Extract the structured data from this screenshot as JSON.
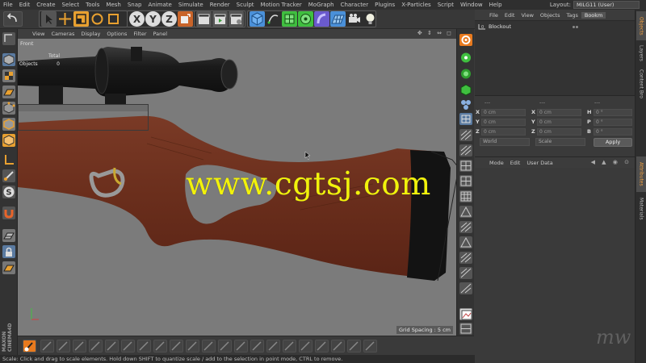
{
  "menubar": {
    "items": [
      "File",
      "Edit",
      "Create",
      "Select",
      "Tools",
      "Mesh",
      "Snap",
      "Animate",
      "Simulate",
      "Render",
      "Sculpt",
      "Motion Tracker",
      "MoGraph",
      "Character",
      "Plugins",
      "X-Particles",
      "Script",
      "Window",
      "Help"
    ],
    "layout_label": "Layout:",
    "layout_value": "MILG11 (User)"
  },
  "viewport": {
    "menu": [
      "View",
      "Cameras",
      "Display",
      "Options",
      "Filter",
      "Panel"
    ],
    "nav_icons": "✥ ⇕ ⇔ ◻",
    "name": "Front",
    "hud": [
      {
        "label": "",
        "value": "Total"
      },
      {
        "label": "Objects",
        "value": "0"
      }
    ],
    "watermark": "www.cgtsj.com",
    "grid_spacing_label": "Grid Spacing : 5 cm"
  },
  "branding": {
    "maxon": "MAXON",
    "cinema": "CINEMA4D"
  },
  "statusbar": {
    "text": "Scale: Click and drag to scale elements. Hold down SHIFT to quantize scale / add to the selection in point mode, CTRL to remove."
  },
  "object_manager": {
    "menu": [
      "File",
      "Edit",
      "View",
      "Objects",
      "Tags",
      "Bookm"
    ],
    "active_tab": "Bookm",
    "objects": [
      {
        "name": "Blockout"
      }
    ]
  },
  "coordinates": {
    "headers": [
      "---",
      "---",
      "---"
    ],
    "rows": [
      {
        "axis": "X",
        "pos": "0 cm",
        "axis2": "X",
        "size": "0 cm",
        "rot_label": "H",
        "rot": "0 °"
      },
      {
        "axis": "Y",
        "pos": "0 cm",
        "axis2": "Y",
        "size": "0 cm",
        "rot_label": "P",
        "rot": "0 °"
      },
      {
        "axis": "Z",
        "pos": "0 cm",
        "axis2": "Z",
        "size": "0 cm",
        "rot_label": "B",
        "rot": "0 °"
      }
    ],
    "mode_select": "World",
    "scale_select": "Scale",
    "apply_label": "Apply"
  },
  "attributes": {
    "menu": [
      "Mode",
      "Edit",
      "User Data"
    ],
    "logo": "mw"
  },
  "vertical_tabs": {
    "objects": "Objects",
    "layers": "Layers",
    "content_browser": "Content Bro",
    "attributes": "Attributes",
    "materials": "Materials"
  },
  "colors": {
    "accent_orange": "#e87a1e",
    "viewport_bg": "#7b7b7b",
    "watermark_yellow": "#f2f20a",
    "tool_blue": "#4a90d9",
    "tool_green": "#3fbf3f"
  }
}
